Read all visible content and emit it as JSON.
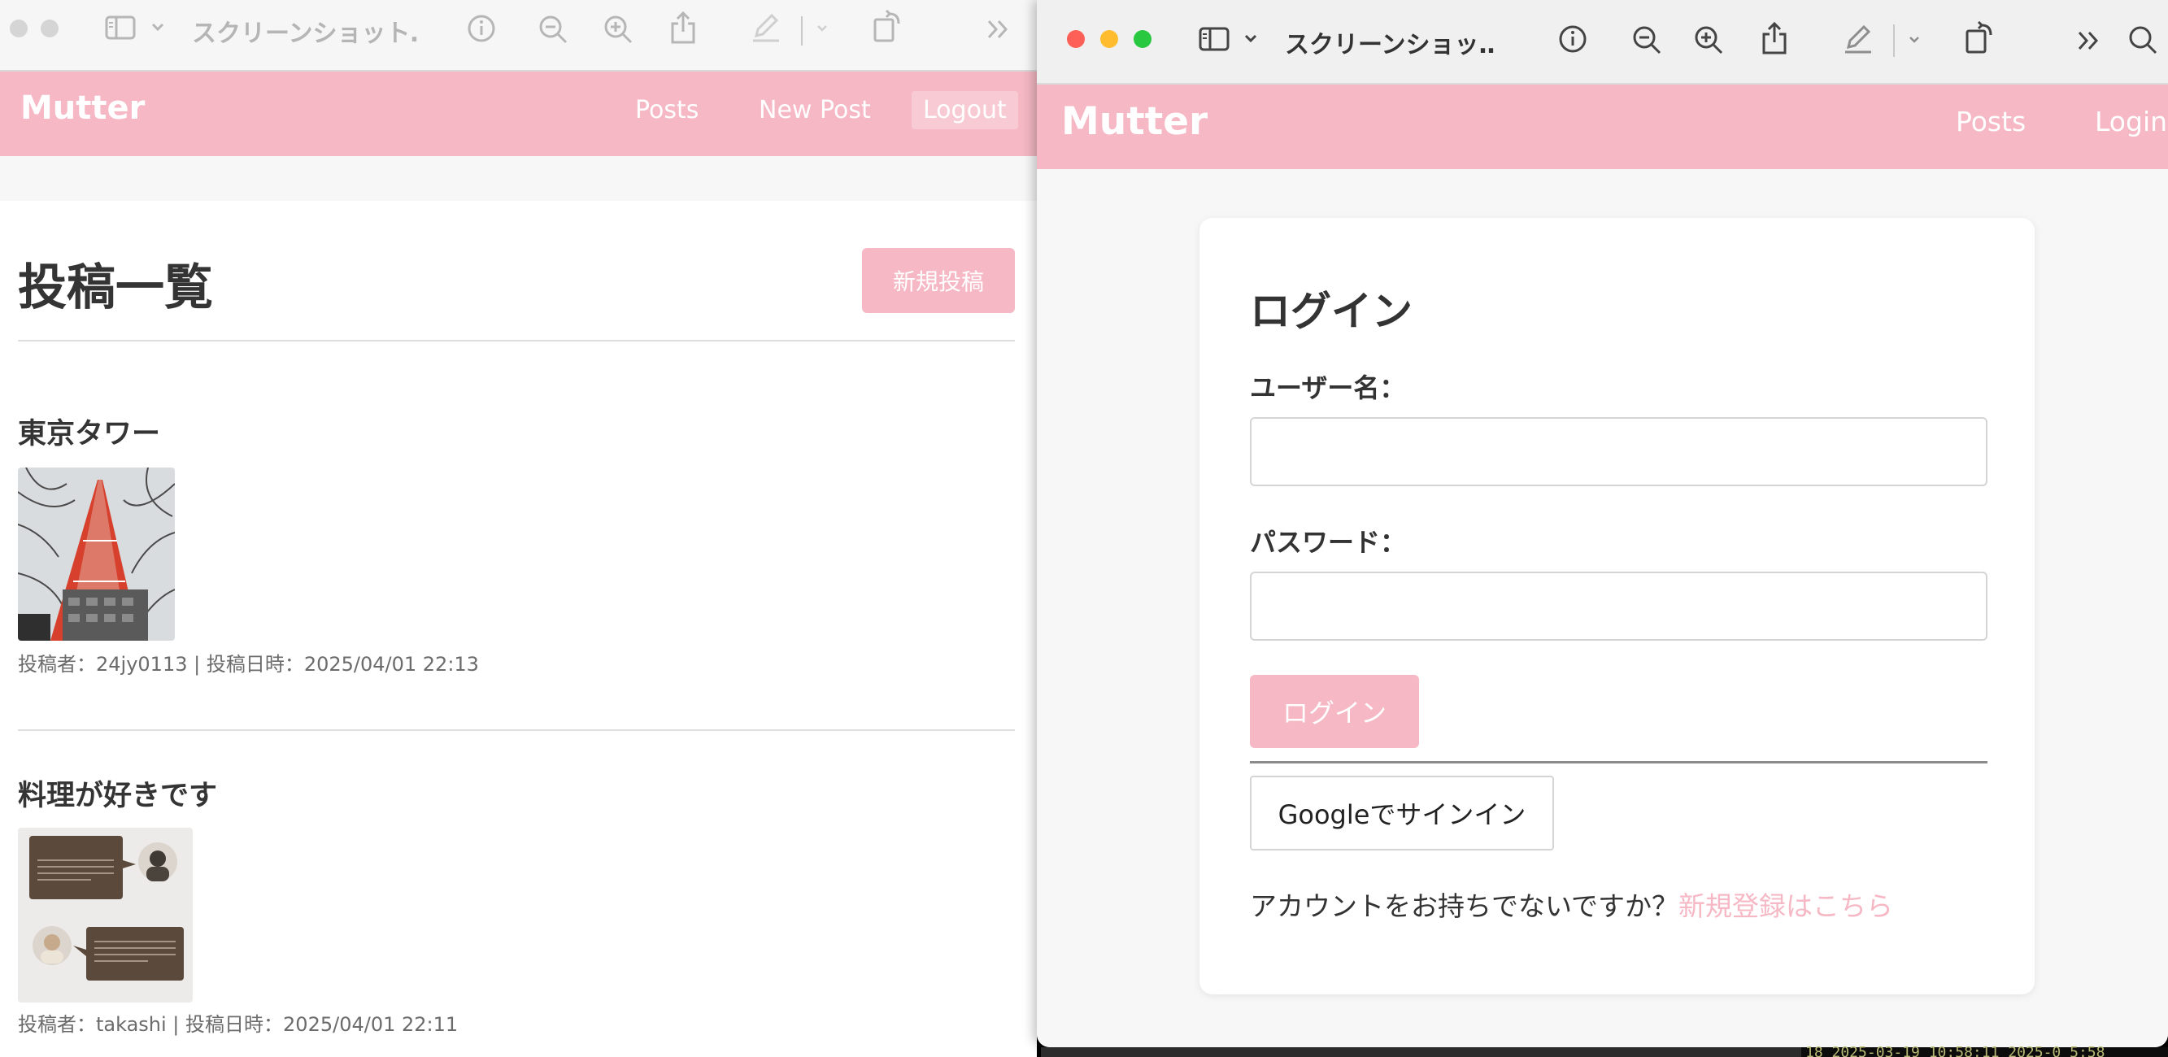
{
  "left_window": {
    "toolbar": {
      "title": "スクリーンショット…",
      "icons": [
        "sidebar-icon",
        "chevron-down-icon",
        "info-icon",
        "zoom-out-icon",
        "zoom-in-icon",
        "share-icon",
        "markup-icon",
        "rotate-icon",
        "more-icon"
      ]
    },
    "app": {
      "brand": "Mutter",
      "nav": {
        "posts": "Posts",
        "new_post": "New Post",
        "logout": "Logout"
      },
      "page_title": "投稿一覧",
      "new_post_button": "新規投稿",
      "posts": [
        {
          "title": "東京タワー",
          "meta": "投稿者：24jy0113 | 投稿日時：2025/04/01 22:13"
        },
        {
          "title": "料理が好きです",
          "meta": "投稿者：takashi | 投稿日時：2025/04/01 22:11"
        }
      ]
    }
  },
  "right_window": {
    "toolbar": {
      "title": "スクリーンショッ…",
      "icons": [
        "sidebar-icon",
        "chevron-down-icon",
        "info-icon",
        "zoom-out-icon",
        "zoom-in-icon",
        "share-icon",
        "markup-icon",
        "rotate-icon",
        "more-icon",
        "search-icon"
      ]
    },
    "app": {
      "brand": "Mutter",
      "nav": {
        "posts": "Posts",
        "login": "Login"
      },
      "login_card": {
        "title": "ログイン",
        "username_label": "ユーザー名：",
        "username_value": "",
        "password_label": "パスワード：",
        "password_value": "",
        "login_button": "ログイン",
        "google_button": "Googleでサインイン",
        "signup_prompt": "アカウントをお持ちでないですか？",
        "signup_link": "新規登録はこちら"
      }
    }
  },
  "background": {
    "terminal_snippet": "18   2025-03-19 10:58:11   2025-0 5:58"
  },
  "colors": {
    "brand_pink": "#f5b8c4",
    "text_dark": "#333333",
    "traffic_red": "#fe5f57",
    "traffic_yellow": "#febc2e",
    "traffic_green": "#28c840"
  }
}
